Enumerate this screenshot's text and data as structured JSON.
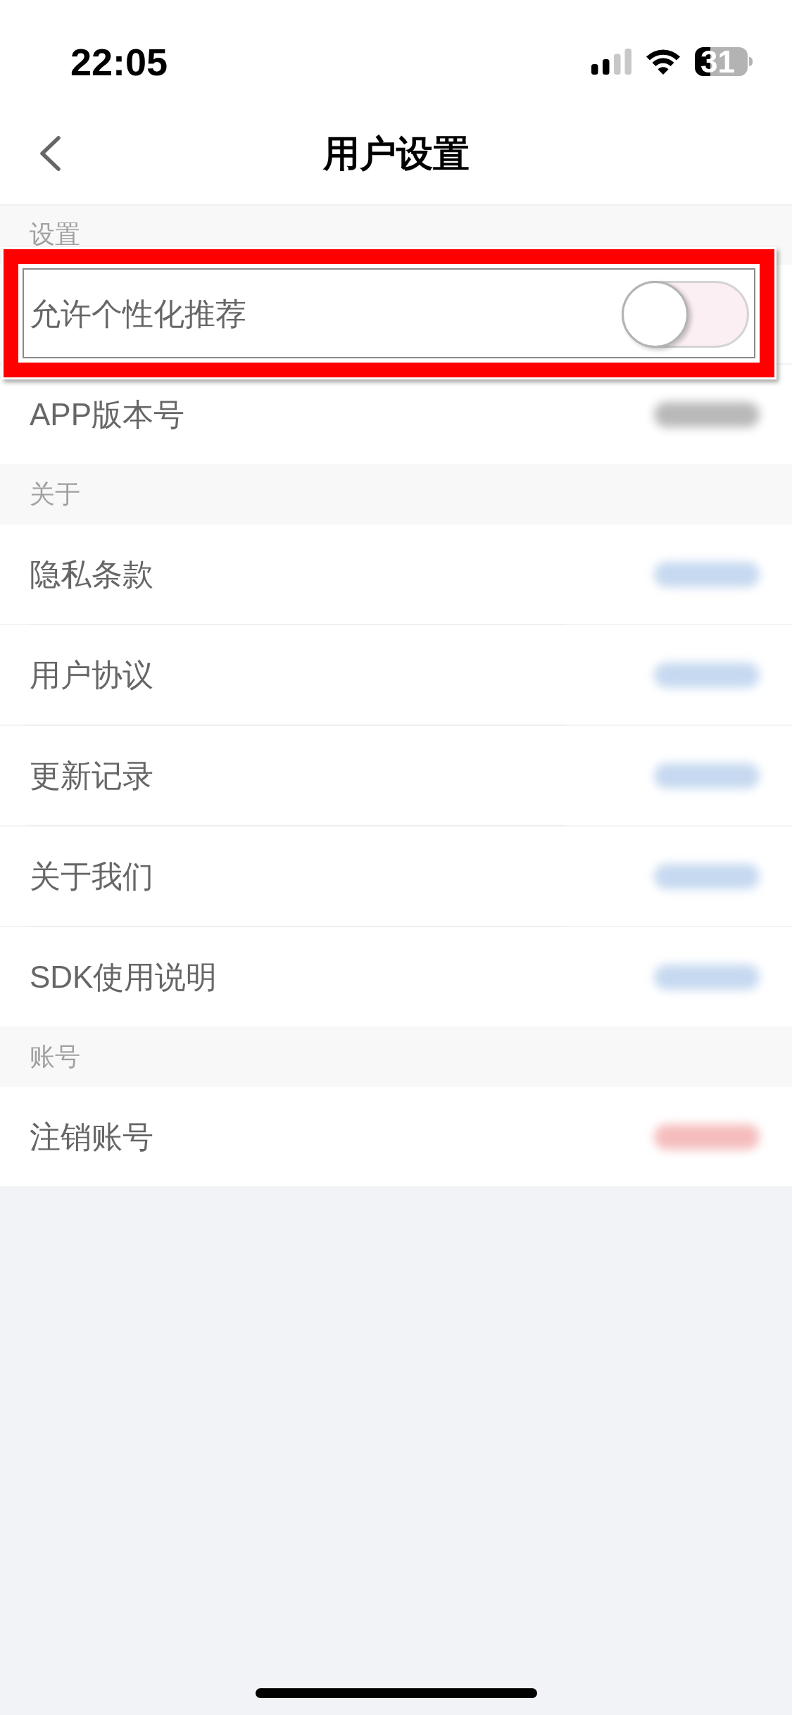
{
  "status_bar": {
    "time": "22:05",
    "battery": "31"
  },
  "nav": {
    "title": "用户设置"
  },
  "sections": [
    {
      "title": "设置",
      "rows": [
        {
          "kind": "toggle",
          "label": "允许个性化推荐",
          "on": false,
          "highlighted": true
        },
        {
          "kind": "value",
          "label": "APP版本号",
          "highlighted": false
        }
      ]
    },
    {
      "title": "关于",
      "rows": [
        {
          "kind": "link",
          "label": "隐私条款",
          "highlighted": false
        },
        {
          "kind": "link",
          "label": "用户协议",
          "highlighted": false
        },
        {
          "kind": "link",
          "label": "更新记录",
          "highlighted": false
        },
        {
          "kind": "link",
          "label": "关于我们",
          "highlighted": false
        },
        {
          "kind": "link",
          "label": "SDK使用说明",
          "highlighted": false
        }
      ]
    },
    {
      "title": "账号",
      "rows": [
        {
          "kind": "danger",
          "label": "注销账号",
          "highlighted": false
        }
      ]
    }
  ]
}
